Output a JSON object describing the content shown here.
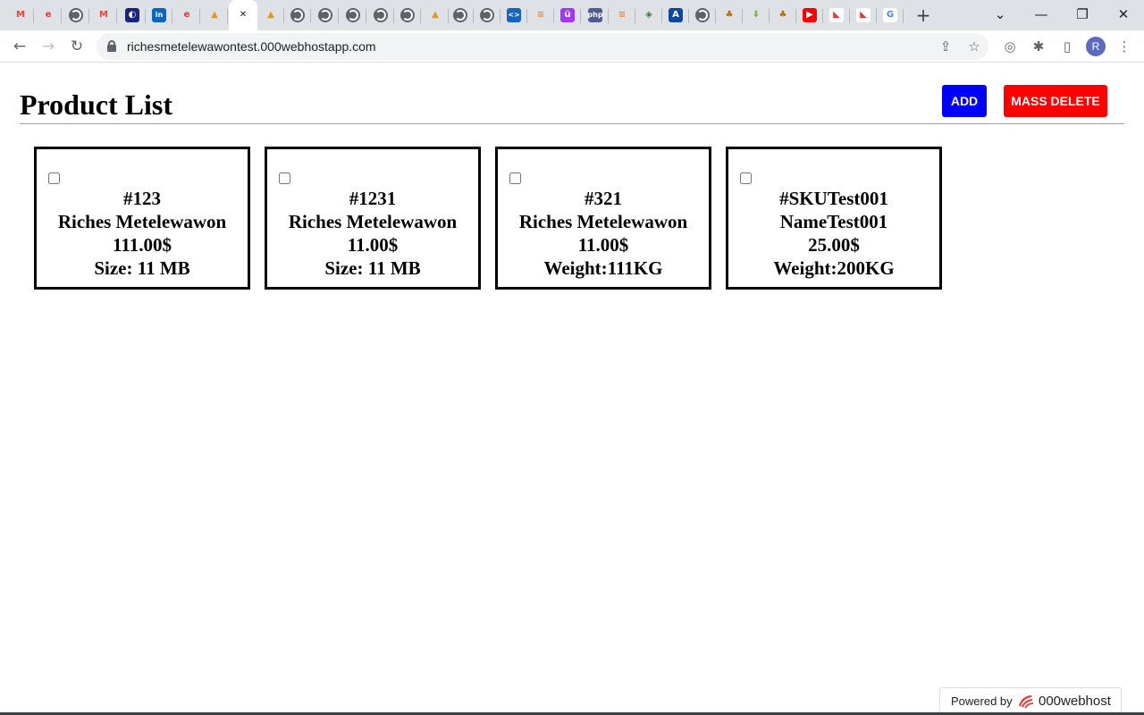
{
  "browser": {
    "tabs": [
      {
        "icon": "gmail-icon",
        "glyph": "M",
        "fg": "#ea4335",
        "bg": "transparent"
      },
      {
        "icon": "000webhost-icon",
        "glyph": "e",
        "fg": "#e53935",
        "bg": "transparent"
      },
      {
        "icon": "globe-icon",
        "glyph": "",
        "fg": "#fff",
        "bg": "globe"
      },
      {
        "icon": "gmail-icon",
        "glyph": "M",
        "fg": "#ea4335",
        "bg": "transparent"
      },
      {
        "icon": "sourcetree-icon",
        "glyph": "◐",
        "fg": "#fff",
        "bg": "#1a237e"
      },
      {
        "icon": "linkedin-icon",
        "glyph": "in",
        "fg": "#fff",
        "bg": "#0a66c2"
      },
      {
        "icon": "000webhost-icon",
        "glyph": "e",
        "fg": "#e53935",
        "bg": "transparent"
      },
      {
        "icon": "phpmyadmin-icon",
        "glyph": "▲",
        "fg": "#f29111",
        "bg": "transparent"
      },
      {
        "icon": "close-icon",
        "glyph": "✕",
        "fg": "#202124",
        "bg": "transparent",
        "active": true
      },
      {
        "icon": "phpmyadmin-icon",
        "glyph": "▲",
        "fg": "#f29111",
        "bg": "transparent"
      },
      {
        "icon": "globe-icon",
        "glyph": "",
        "fg": "#fff",
        "bg": "globe"
      },
      {
        "icon": "globe-icon",
        "glyph": "",
        "fg": "#fff",
        "bg": "globe"
      },
      {
        "icon": "globe-icon",
        "glyph": "",
        "fg": "#fff",
        "bg": "globe"
      },
      {
        "icon": "globe-icon",
        "glyph": "",
        "fg": "#fff",
        "bg": "globe"
      },
      {
        "icon": "globe-icon",
        "glyph": "",
        "fg": "#fff",
        "bg": "globe"
      },
      {
        "icon": "phpmyadmin-icon",
        "glyph": "▲",
        "fg": "#f29111",
        "bg": "transparent"
      },
      {
        "icon": "globe-icon",
        "glyph": "",
        "fg": "#fff",
        "bg": "globe"
      },
      {
        "icon": "globe-icon",
        "glyph": "",
        "fg": "#fff",
        "bg": "globe"
      },
      {
        "icon": "code-icon",
        "glyph": "<>",
        "fg": "#fff",
        "bg": "#1565c0"
      },
      {
        "icon": "stackoverflow-icon",
        "glyph": "≡",
        "fg": "#f48024",
        "bg": "transparent"
      },
      {
        "icon": "udemy-icon",
        "glyph": "ü",
        "fg": "#fff",
        "bg": "#a435f0"
      },
      {
        "icon": "php-icon",
        "glyph": "php",
        "fg": "#fff",
        "bg": "#4f5b93"
      },
      {
        "icon": "stackoverflow-icon",
        "glyph": "≡",
        "fg": "#f48024",
        "bg": "transparent"
      },
      {
        "icon": "diamond-icon",
        "glyph": "◈",
        "fg": "#2e7d32",
        "bg": "transparent"
      },
      {
        "icon": "a-icon",
        "glyph": "A",
        "fg": "#fff",
        "bg": "#0d47a1"
      },
      {
        "icon": "globe-icon",
        "glyph": "",
        "fg": "#fff",
        "bg": "globe"
      },
      {
        "icon": "bell-icon",
        "glyph": "♣",
        "fg": "#bf6f00",
        "bg": "transparent"
      },
      {
        "icon": "download-icon",
        "glyph": "⬇",
        "fg": "#7cb342",
        "bg": "transparent"
      },
      {
        "icon": "bell-icon",
        "glyph": "♣",
        "fg": "#bf6f00",
        "bg": "transparent"
      },
      {
        "icon": "youtube-icon",
        "glyph": "▶",
        "fg": "#fff",
        "bg": "#ff0000"
      },
      {
        "icon": "kotlin-icon",
        "glyph": "◣",
        "fg": "#e53935",
        "bg": "#fff"
      },
      {
        "icon": "kotlin-icon",
        "glyph": "◣",
        "fg": "#e53935",
        "bg": "#fff"
      },
      {
        "icon": "google-icon",
        "glyph": "G",
        "fg": "#4285f4",
        "bg": "#fff"
      }
    ],
    "new_tab_glyph": "+",
    "window_controls": {
      "list": "⌄",
      "minimize": "—",
      "restore": "❐",
      "close": "✕"
    },
    "nav": {
      "back": "←",
      "forward": "→",
      "reload": "↻"
    },
    "url": "richesmetelewawontest.000webhostapp.com",
    "omnibox_icons": {
      "share": "⇪",
      "star": "☆"
    },
    "toolbar_icons": {
      "extension_a": "◎",
      "puzzle": "✱",
      "sidepanel": "▯",
      "menu": "⋮"
    },
    "profile_initial": "R"
  },
  "page": {
    "title": "Product List",
    "add_label": "ADD",
    "mass_delete_label": "MASS DELETE",
    "products": [
      {
        "sku": "#123",
        "name": "Riches Metelewawon",
        "price": "111.00$",
        "attribute": "Size: 11 MB"
      },
      {
        "sku": "#1231",
        "name": "Riches Metelewawon",
        "price": "11.00$",
        "attribute": "Size: 11 MB"
      },
      {
        "sku": "#321",
        "name": "Riches Metelewawon",
        "price": "11.00$",
        "attribute": "Weight:111KG"
      },
      {
        "sku": "#SKUTest001",
        "name": "NameTest001",
        "price": "25.00$",
        "attribute": "Weight:200KG"
      }
    ],
    "powered": {
      "label": "Powered by",
      "brand": "000webhost"
    }
  },
  "colors": {
    "add": "#0000ff",
    "mass_delete": "#ff0000",
    "tabstrip": "#dee1e6"
  }
}
